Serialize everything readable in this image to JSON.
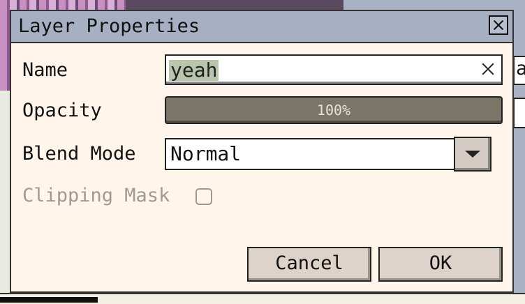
{
  "dialog": {
    "title": "Layer Properties",
    "fields": {
      "name_label": "Name",
      "name_value": "yeah",
      "opacity_label": "Opacity",
      "opacity_value": "100%",
      "blend_label": "Blend Mode",
      "blend_value": "Normal",
      "clipping_label": "Clipping Mask",
      "clipping_checked": false
    },
    "buttons": {
      "cancel": "Cancel",
      "ok": "OK"
    }
  },
  "background": {
    "right_field_fragment": "a"
  },
  "colors": {
    "titlebar": "#a7b0c2",
    "dialog_bg": "#fff5ea",
    "opacity_fill": "#7a7566",
    "selection": "#b9c6ab"
  }
}
